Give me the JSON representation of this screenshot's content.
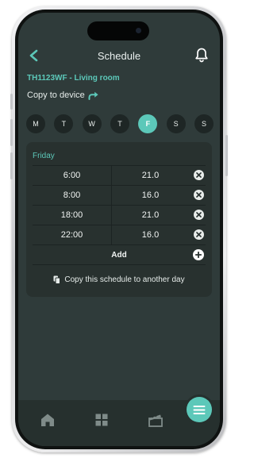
{
  "header": {
    "title": "Schedule",
    "back_icon": "chevron-left-icon",
    "bell_icon": "bell-icon"
  },
  "device": {
    "name": "TH1123WF - Living room"
  },
  "copy_device": {
    "label": "Copy to device",
    "icon": "share-arrow-icon"
  },
  "days": [
    {
      "label": "M",
      "active": false
    },
    {
      "label": "T",
      "active": false
    },
    {
      "label": "W",
      "active": false
    },
    {
      "label": "T",
      "active": false
    },
    {
      "label": "F",
      "active": true
    },
    {
      "label": "S",
      "active": false
    },
    {
      "label": "S",
      "active": false
    }
  ],
  "schedule": {
    "day_title": "Friday",
    "entries": [
      {
        "time": "6:00",
        "temp": "21.0"
      },
      {
        "time": "8:00",
        "temp": "16.0"
      },
      {
        "time": "18:00",
        "temp": "21.0"
      },
      {
        "time": "22:00",
        "temp": "16.0"
      }
    ],
    "add_label": "Add",
    "copy_label": "Copy this schedule to another day"
  },
  "tabbar": {
    "items": [
      "home-icon",
      "grid-icon",
      "clapperboard-icon"
    ],
    "menu_icon": "menu-icon"
  },
  "colors": {
    "accent": "#5cc8b9",
    "background": "#2f3b3a",
    "card": "#28312f"
  }
}
